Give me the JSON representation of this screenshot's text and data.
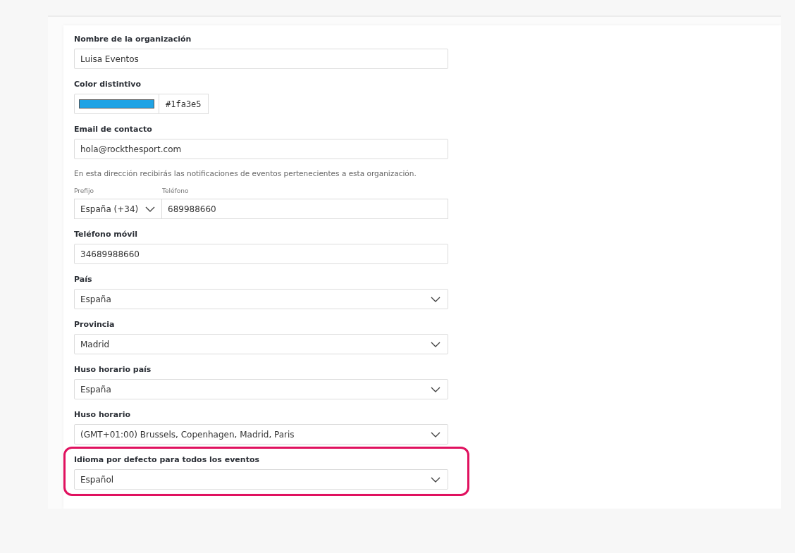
{
  "fields": [
    {
      "kind": "text",
      "label": "Nombre de la organización",
      "value": "Luisa Eventos",
      "highlighted": false
    },
    {
      "kind": "color",
      "label": "Color distintivo",
      "color": "#1fa3e5",
      "value": "#1fa3e5",
      "highlighted": false
    },
    {
      "kind": "text",
      "label": "Email de contacto",
      "value": "hola@rockthesport.com",
      "help": "En esta dirección recibirás las notificaciones de eventos pertenecientes a esta organización.",
      "highlighted": false
    },
    {
      "kind": "phone",
      "prefix_label": "Prefijo",
      "prefix_value": "España (+34)",
      "phone_label": "Teléfono",
      "phone_value": "689988660",
      "highlighted": false
    },
    {
      "kind": "text",
      "label": "Teléfono móvil",
      "value": "34689988660",
      "highlighted": false
    },
    {
      "kind": "select",
      "label": "País",
      "value": "España",
      "highlighted": false
    },
    {
      "kind": "select",
      "label": "Provincia",
      "value": "Madrid",
      "highlighted": false
    },
    {
      "kind": "select",
      "label": "Huso horario país",
      "value": "España",
      "highlighted": false
    },
    {
      "kind": "select",
      "label": "Huso horario",
      "value": "(GMT+01:00) Brussels, Copenhagen, Madrid, Paris",
      "highlighted": false
    },
    {
      "kind": "select",
      "label": "Idioma por defecto para todos los eventos",
      "value": "Español",
      "highlighted": true
    }
  ]
}
